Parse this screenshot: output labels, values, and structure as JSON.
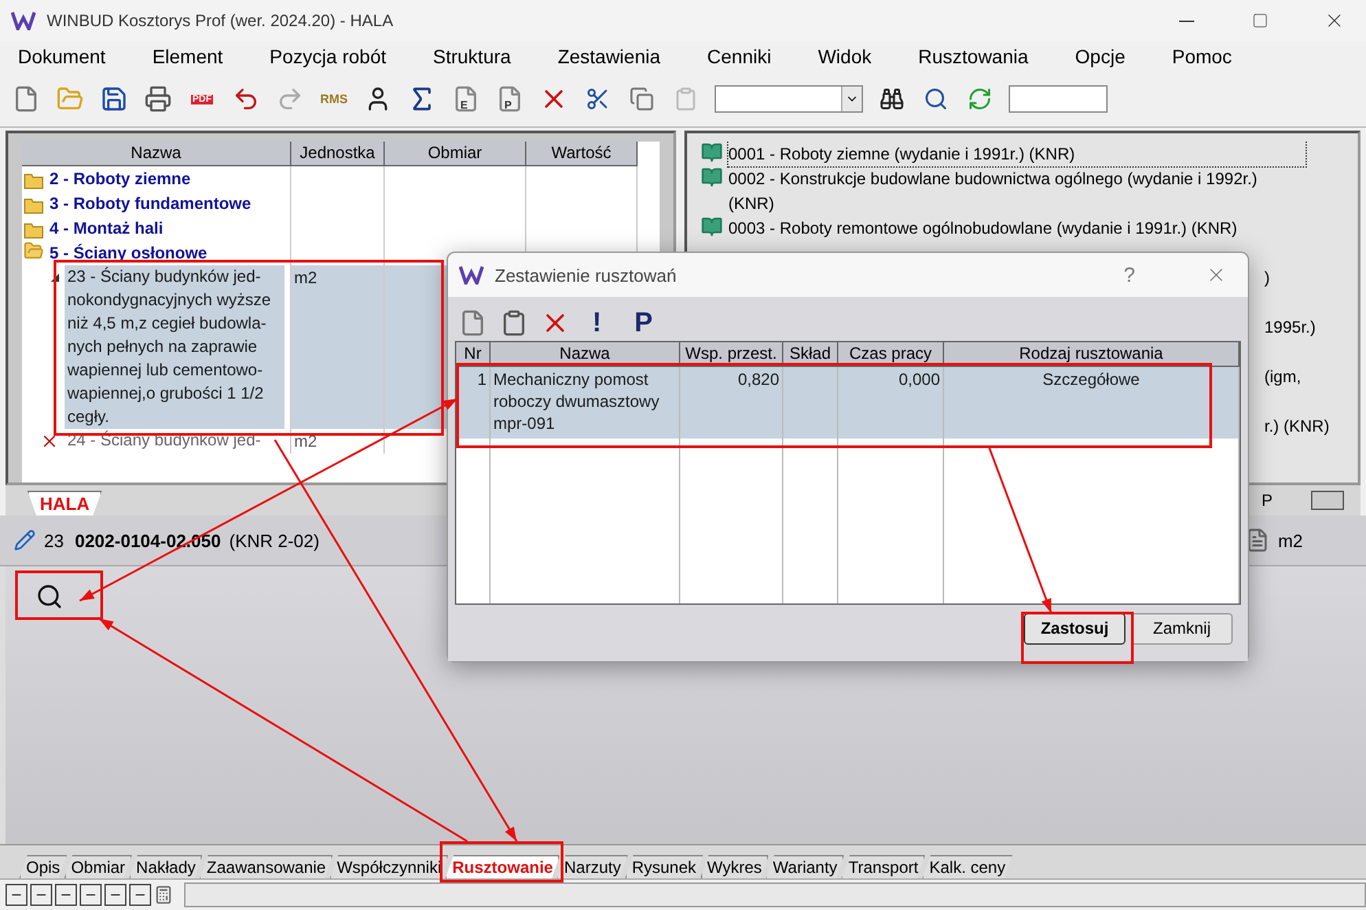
{
  "window": {
    "title": "WINBUD Kosztorys Prof (wer. 2024.20) - HALA"
  },
  "menu": [
    "Dokument",
    "Element",
    "Pozycja robót",
    "Struktura",
    "Zestawienia",
    "Cenniki",
    "Widok",
    "Rusztowania",
    "Opcje",
    "Pomoc"
  ],
  "toolbar": {
    "pdf_label": "PDF",
    "rms_label": "RMS",
    "doc_letters": [
      "E",
      "P"
    ]
  },
  "left_panel": {
    "columns": [
      "Nazwa",
      "Jednostka",
      "Obmiar",
      "Wartość"
    ],
    "rows": [
      {
        "kind": "folder",
        "label": "2 - Roboty ziemne",
        "expanded": false
      },
      {
        "kind": "folder",
        "label": "3 - Roboty fundamentowe",
        "expanded": false
      },
      {
        "kind": "folder",
        "label": "4 - Montaż hali",
        "expanded": false
      },
      {
        "kind": "folder",
        "label": "5 - Ściany osłonowe",
        "expanded": true,
        "children": [
          {
            "kind": "position",
            "label": "23 - Ściany budynków jed-nokondygnacyjnych wyższe niż 4,5 m,z cegieł budowla-nych pełnych na zaprawie wapiennej lub cementowo-wapiennej,o grubości 1 1/2 cegły.",
            "unit": "m2",
            "selected": true
          },
          {
            "kind": "deleted",
            "label": "24 - Ściany budynków jed-",
            "unit": "m2",
            "selected": false
          }
        ]
      }
    ]
  },
  "tabs": [
    {
      "label": "HALA",
      "selected": true
    }
  ],
  "right_panel": {
    "items": [
      {
        "kind": "catalog",
        "text": "0001 - Roboty ziemne (wydanie i 1991r.) (KNR)",
        "focused": true
      },
      {
        "kind": "catalog",
        "text": "0002 - Konstrukcje budowlane budownictwa ogólnego (wydanie i 1992r.) (KNR)",
        "focused": false
      },
      {
        "kind": "catalog",
        "text": "0003 - Roboty remontowe ogólnobudowlane (wydanie i 1991r.) (KNR)",
        "focused": false
      },
      {
        "kind": "fragment",
        "text": ")"
      },
      {
        "kind": "fragment",
        "text": "1995r.)"
      },
      {
        "kind": "fragment",
        "text": "(igm,"
      },
      {
        "kind": "fragment",
        "text": "r.) (KNR)"
      }
    ],
    "tab": "P"
  },
  "detail": {
    "number": "23",
    "code": "0202-0104-02.050",
    "catalog": "(KNR 2-02)",
    "unit": "m2"
  },
  "dialog": {
    "title": "Zestawienie rusztowań",
    "help": "?",
    "tools": [
      "!",
      "P"
    ],
    "columns": [
      "Nr",
      "Nazwa",
      "Wsp. przest.",
      "Skład",
      "Czas pracy",
      "Rodzaj rusztowania"
    ],
    "rows": [
      {
        "nr": "1",
        "name": "Mechaniczny pomost roboczy dwumasztowy mpr-091",
        "factor": "0,820",
        "time": "0,000",
        "type": "Szczegółowe",
        "selected": true
      }
    ],
    "buttons": [
      {
        "label": "Zastosuj",
        "default": true
      },
      {
        "label": "Zamknij",
        "default": false
      }
    ]
  },
  "bottom_tabs": [
    {
      "label": "Opis",
      "selected": false
    },
    {
      "label": "Obmiar",
      "selected": false
    },
    {
      "label": "Nakłady",
      "selected": false
    },
    {
      "label": "Zaawansowanie",
      "selected": false
    },
    {
      "label": "Współczynniki",
      "selected": false
    },
    {
      "label": "Rusztowanie",
      "selected": true
    },
    {
      "label": "Narzuty",
      "selected": false
    },
    {
      "label": "Rysunek",
      "selected": false
    },
    {
      "label": "Wykres",
      "selected": false
    },
    {
      "label": "Warianty",
      "selected": false
    },
    {
      "label": "Transport",
      "selected": false
    },
    {
      "label": "Kalk. ceny",
      "selected": false
    }
  ]
}
